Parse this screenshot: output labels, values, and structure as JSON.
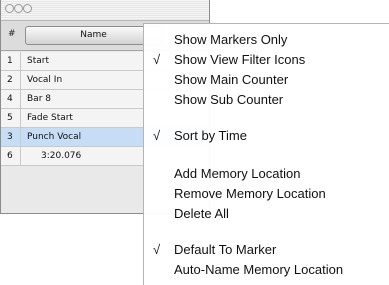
{
  "window": {
    "header": {
      "number_label": "#",
      "name_label": "Name"
    },
    "rows": [
      {
        "num": "1",
        "name": "Start"
      },
      {
        "num": "2",
        "name": "Vocal In"
      },
      {
        "num": "4",
        "name": "Bar 8"
      },
      {
        "num": "5",
        "name": "Fade Start"
      },
      {
        "num": "3",
        "name": "Punch Vocal",
        "selected": true
      },
      {
        "num": "6",
        "name": "3:20.076"
      }
    ]
  },
  "menu": {
    "check_glyph": "√",
    "items": [
      {
        "label": "Show Markers Only",
        "checked": false
      },
      {
        "label": "Show View Filter Icons",
        "checked": true
      },
      {
        "label": "Show Main Counter",
        "checked": false
      },
      {
        "label": "Show Sub Counter",
        "checked": false
      },
      {
        "label": "Sort by Time",
        "checked": true
      },
      {
        "label": "Add Memory Location",
        "checked": false
      },
      {
        "label": "Remove Memory Location",
        "checked": false
      },
      {
        "label": "Delete All",
        "checked": false
      },
      {
        "label": "Default To Marker",
        "checked": true
      },
      {
        "label": "Auto-Name Memory Location",
        "checked": false
      }
    ]
  },
  "colors": {
    "selected_row": "#c7dcf5"
  }
}
